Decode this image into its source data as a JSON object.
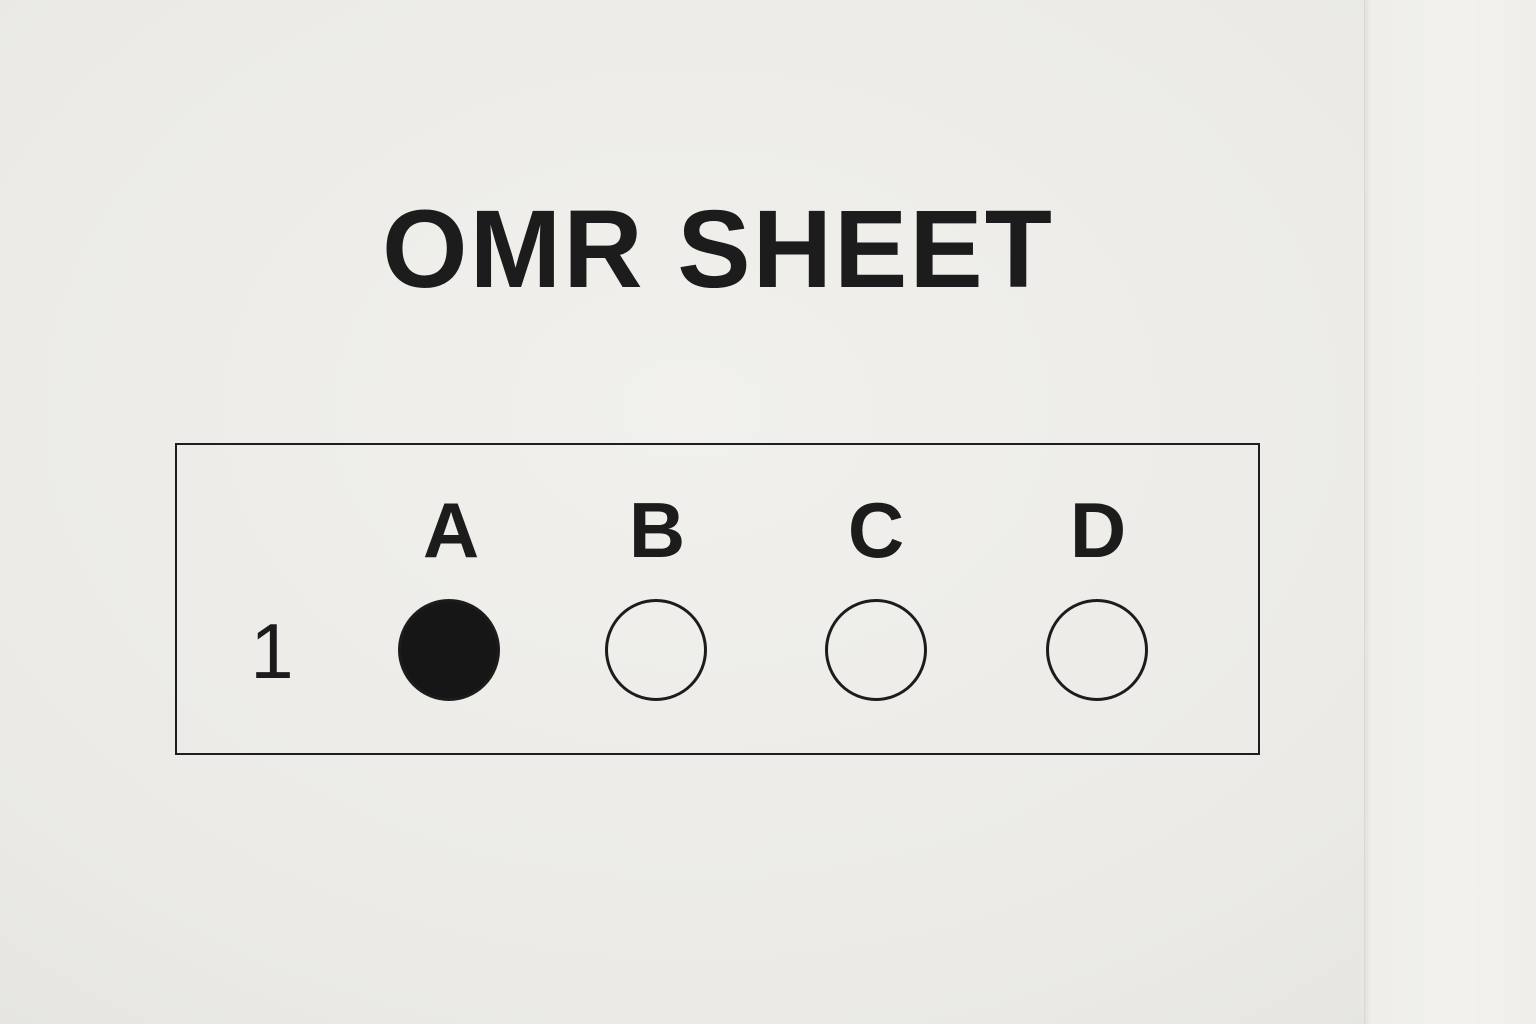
{
  "title": "OMR SHEET",
  "question": {
    "number": "1",
    "selected": "A",
    "options": [
      {
        "label": "A",
        "filled": true
      },
      {
        "label": "B",
        "filled": false
      },
      {
        "label": "C",
        "filled": false
      },
      {
        "label": "D",
        "filled": false
      }
    ]
  },
  "colors": {
    "paper": "#ecebe7",
    "ink": "#1c1c1c"
  }
}
